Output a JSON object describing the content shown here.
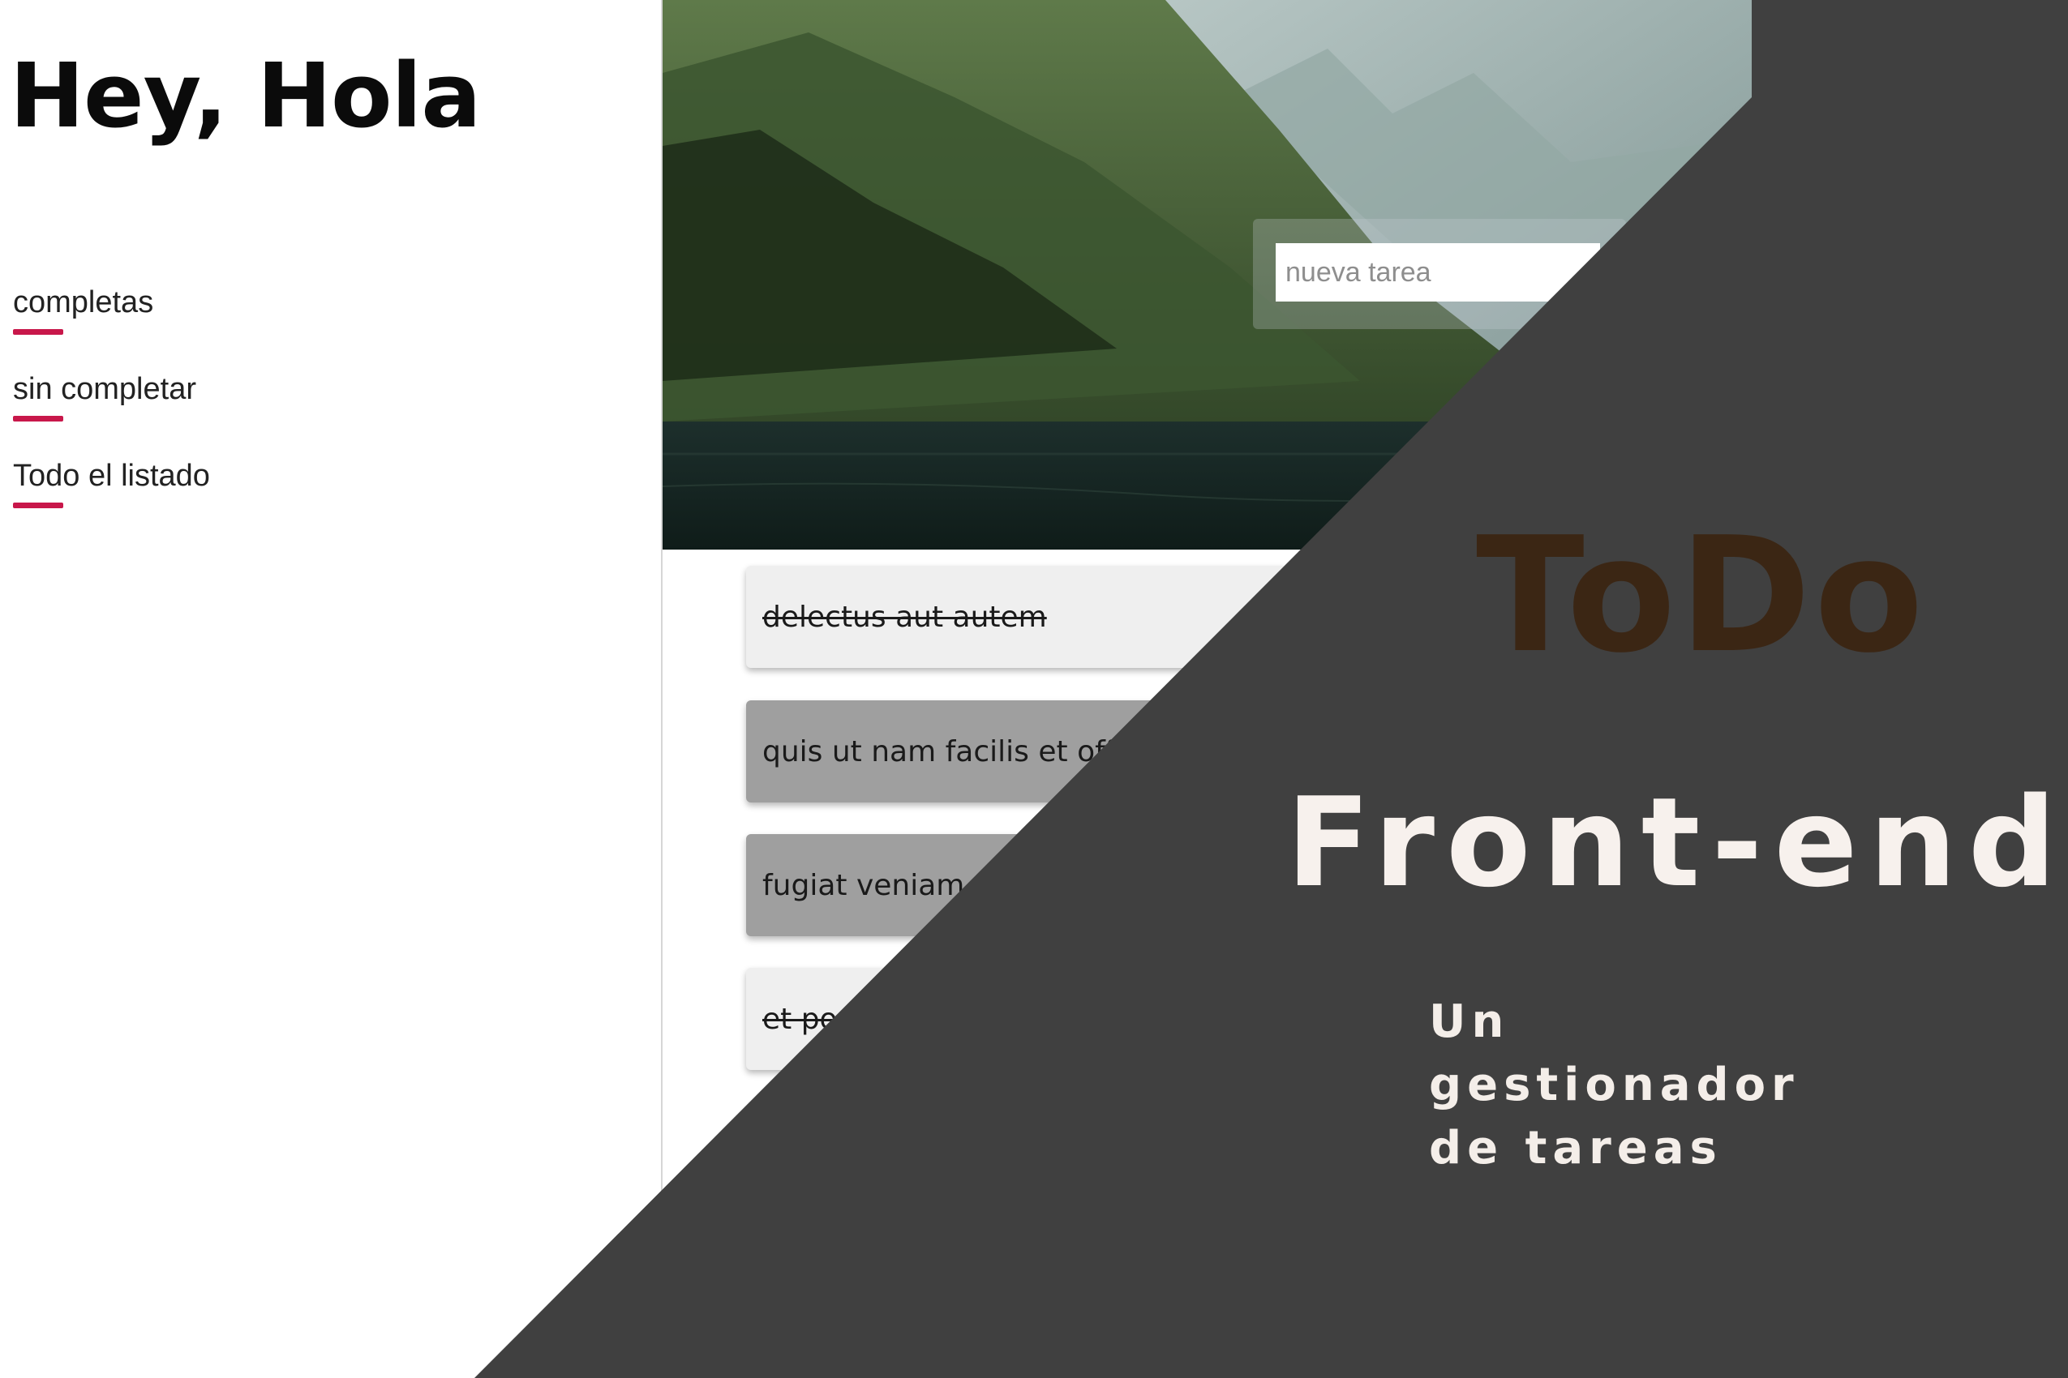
{
  "app": {
    "greeting": "Hey, Hola"
  },
  "filters": [
    {
      "label": "completas"
    },
    {
      "label": "sin completar"
    },
    {
      "label": "Todo el listado"
    }
  ],
  "task_input": {
    "placeholder": "nueva tarea",
    "value": ""
  },
  "tasks": [
    {
      "text": "delectus aut autem",
      "status": "completed"
    },
    {
      "text": "quis ut nam facilis et officia qui",
      "status": "pending"
    },
    {
      "text": "fugiat veniam minus",
      "status": "pending"
    },
    {
      "text": "et porro tempora",
      "status": "completed"
    }
  ],
  "promo": {
    "title": "ToDo",
    "subtitle": "Front-end",
    "tagline": "Un gestionador de tareas"
  },
  "colors": {
    "accent": "#c8174a",
    "overlay": "#404040",
    "promo_title": "#3b2614",
    "promo_text": "#f7f1ed",
    "task_done_bg": "#efefef",
    "task_pending_bg": "#9f9f9f"
  }
}
